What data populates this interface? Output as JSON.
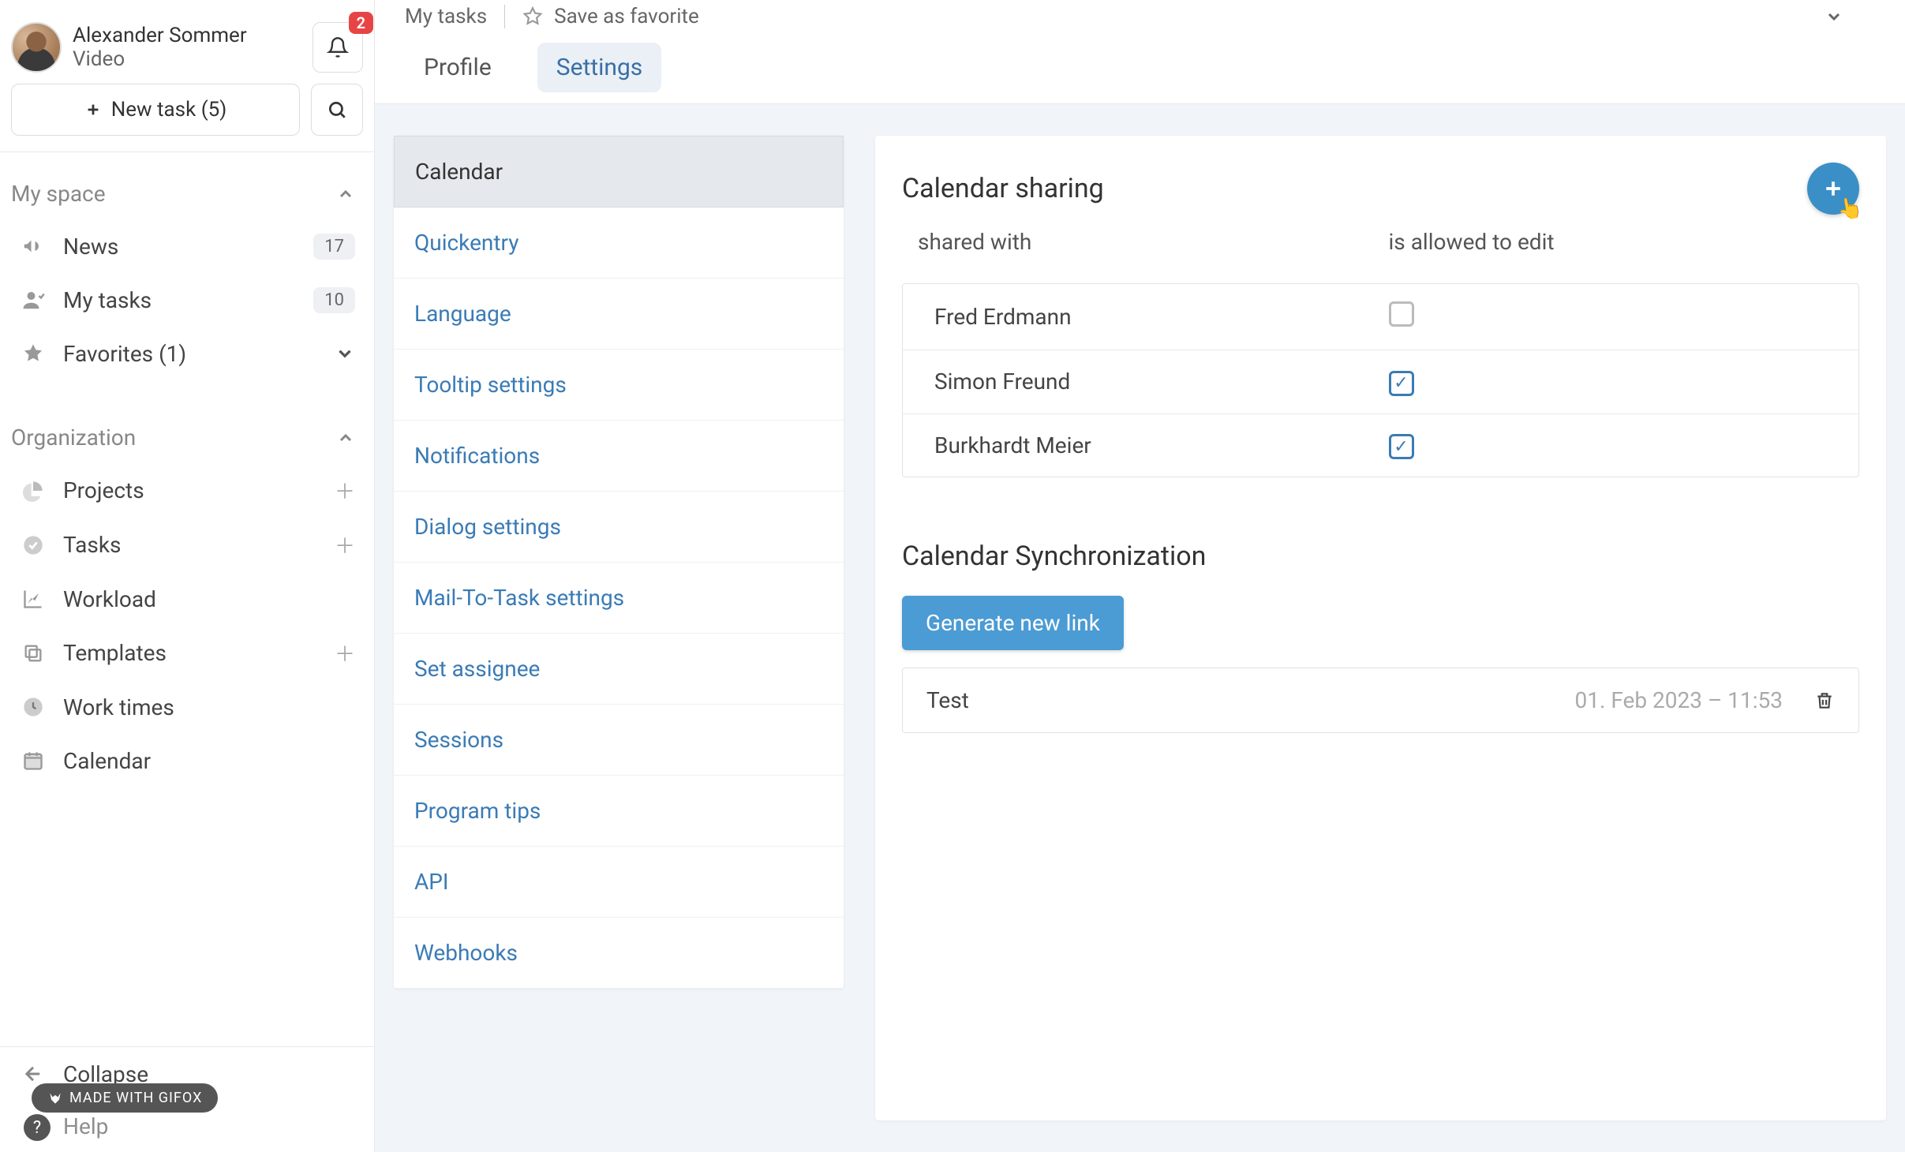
{
  "user": {
    "name": "Alexander Sommer",
    "subtitle": "Video"
  },
  "notifications_badge": "2",
  "new_task_label": "New task (5)",
  "sections": {
    "myspace": {
      "title": "My space",
      "items": [
        {
          "label": "News",
          "badge": "17"
        },
        {
          "label": "My tasks",
          "badge": "10"
        },
        {
          "label": "Favorites (1)"
        }
      ]
    },
    "org": {
      "title": "Organization",
      "items": [
        {
          "label": "Projects"
        },
        {
          "label": "Tasks"
        },
        {
          "label": "Workload"
        },
        {
          "label": "Templates"
        },
        {
          "label": "Work times"
        },
        {
          "label": "Calendar"
        }
      ]
    }
  },
  "footer": {
    "collapse": "Collapse",
    "help": "Help",
    "gifox": "MADE WITH GIFOX"
  },
  "breadcrumb": {
    "root": "My tasks",
    "save_favorite": "Save as favorite"
  },
  "tabs": {
    "profile": "Profile",
    "settings": "Settings"
  },
  "settings_nav": [
    "Calendar",
    "Quickentry",
    "Language",
    "Tooltip settings",
    "Notifications",
    "Dialog settings",
    "Mail-To-Task settings",
    "Set assignee",
    "Sessions",
    "Program tips",
    "API",
    "Webhooks"
  ],
  "sharing": {
    "title": "Calendar sharing",
    "col_shared": "shared with",
    "col_edit": "is allowed to edit",
    "rows": [
      {
        "name": "Fred Erdmann",
        "edit": false
      },
      {
        "name": "Simon Freund",
        "edit": true
      },
      {
        "name": "Burkhardt Meier",
        "edit": true
      }
    ]
  },
  "sync": {
    "title": "Calendar Synchronization",
    "button": "Generate new link",
    "rows": [
      {
        "name": "Test",
        "time": "01. Feb 2023 – 11:53"
      }
    ]
  }
}
